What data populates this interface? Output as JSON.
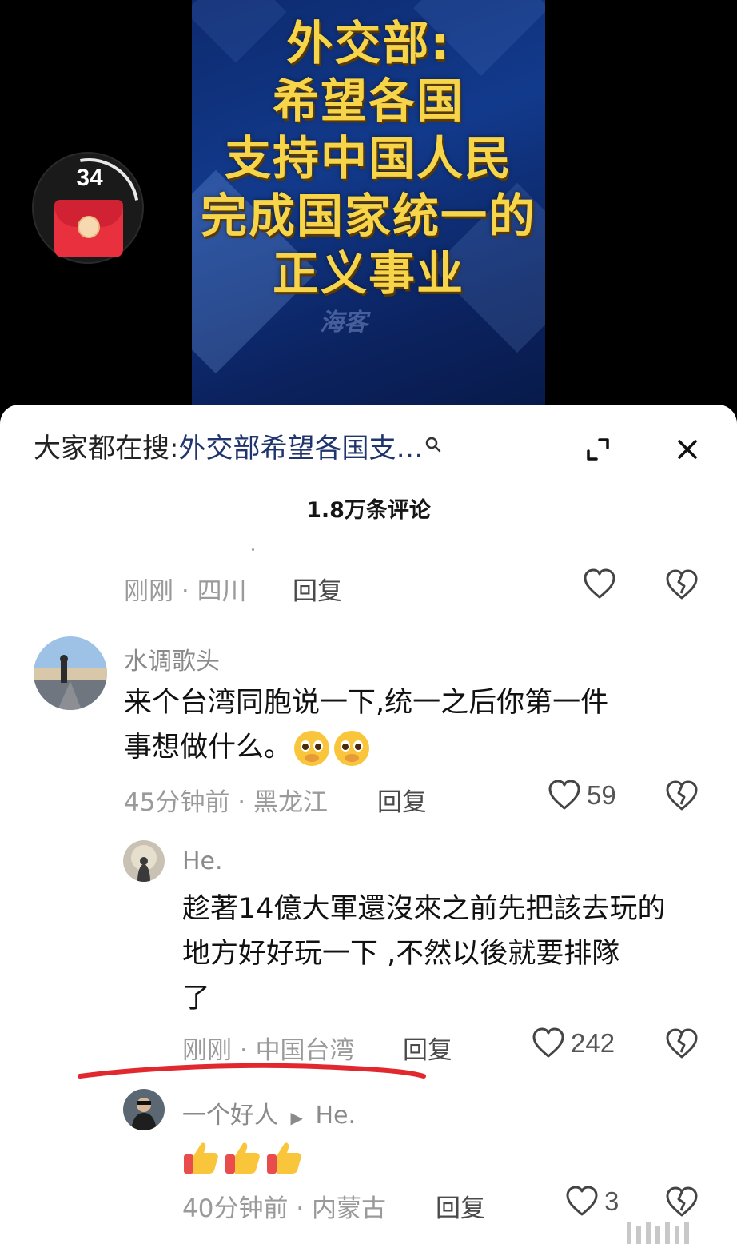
{
  "video": {
    "headline_lines": [
      "外交部:",
      "希望各国",
      "支持中国人民",
      "完成国家统一的",
      "正义事业"
    ],
    "watermark": "海客",
    "packet_count": "34"
  },
  "sheet": {
    "search_prefix": "大家都在搜:",
    "search_query": "外交部希望各国支…",
    "comment_count": "1.8万条评论"
  },
  "comments": [
    {
      "meta_time": "刚刚",
      "meta_location": "四川",
      "reply": "回复"
    },
    {
      "username": "水调歌头",
      "text_line1": "来个台湾同胞说一下,统一之后你第一件",
      "text_line2": "事想做什么。",
      "meta_time": "45分钟前",
      "meta_location": "黑龙江",
      "reply": "回复",
      "likes": "59"
    },
    {
      "username": "He.",
      "text_line1": "趁著14億大軍還沒來之前先把該去玩的",
      "text_line2": "地方好好玩一下 ,不然以後就要排隊",
      "text_line3": "了",
      "meta_time": "刚刚",
      "meta_location": "中国台湾",
      "reply": "回复",
      "likes": "242"
    },
    {
      "username": "一个好人",
      "reply_to": "He.",
      "meta_time": "40分钟前",
      "meta_location": "内蒙古",
      "reply": "回复",
      "likes": "3"
    }
  ],
  "icons": {
    "search": "search-icon",
    "expand": "expand-icon",
    "close": "close-icon",
    "like": "heart-icon",
    "dislike": "broken-heart-icon",
    "emoji": "pleading-face-emoji",
    "thumbs": "thumbs-up-emoji"
  },
  "colors": {
    "headline": "#f6d54a",
    "video_bg": "#123a8c",
    "search_query": "#20356e",
    "underline": "#e0282e",
    "packet": "#e8303f"
  }
}
